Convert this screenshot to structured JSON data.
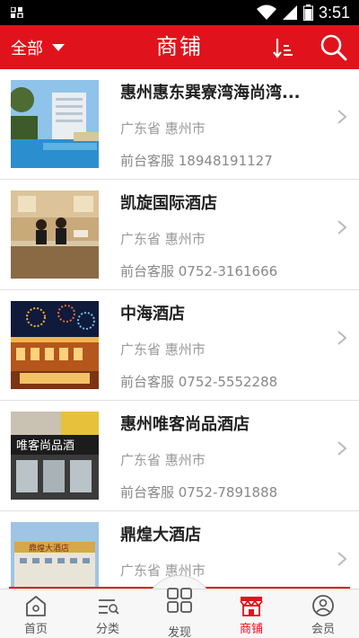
{
  "status_bar": {
    "time": "3:51"
  },
  "header": {
    "filter_label": "全部",
    "title": "商铺"
  },
  "shops": [
    {
      "name": "惠州惠东巽寮湾海尚湾...",
      "region": "广东省 惠州市",
      "phone": "前台客服 18948191127"
    },
    {
      "name": "凯旋国际酒店",
      "region": "广东省 惠州市",
      "phone": "前台客服 0752-3161666"
    },
    {
      "name": "中海酒店",
      "region": "广东省 惠州市",
      "phone": "前台客服 0752-5552288"
    },
    {
      "name": "惠州唯客尚品酒店",
      "region": "广东省 惠州市",
      "phone": "前台客服 0752-7891888"
    },
    {
      "name": "鼎煌大酒店",
      "region": "广东省 惠州市",
      "phone": ""
    }
  ],
  "thumb_signs": {
    "shop4": "唯客尚品酒",
    "shop5": "鼎煌大酒店"
  },
  "bottom_nav": [
    {
      "label": "首页",
      "icon": "home-icon"
    },
    {
      "label": "分类",
      "icon": "category-icon"
    },
    {
      "label": "发现",
      "icon": "grid-icon"
    },
    {
      "label": "商铺",
      "icon": "store-icon"
    },
    {
      "label": "会员",
      "icon": "user-icon"
    }
  ],
  "colors": {
    "brand_red": "#e0131c",
    "active_tab": "商铺"
  }
}
